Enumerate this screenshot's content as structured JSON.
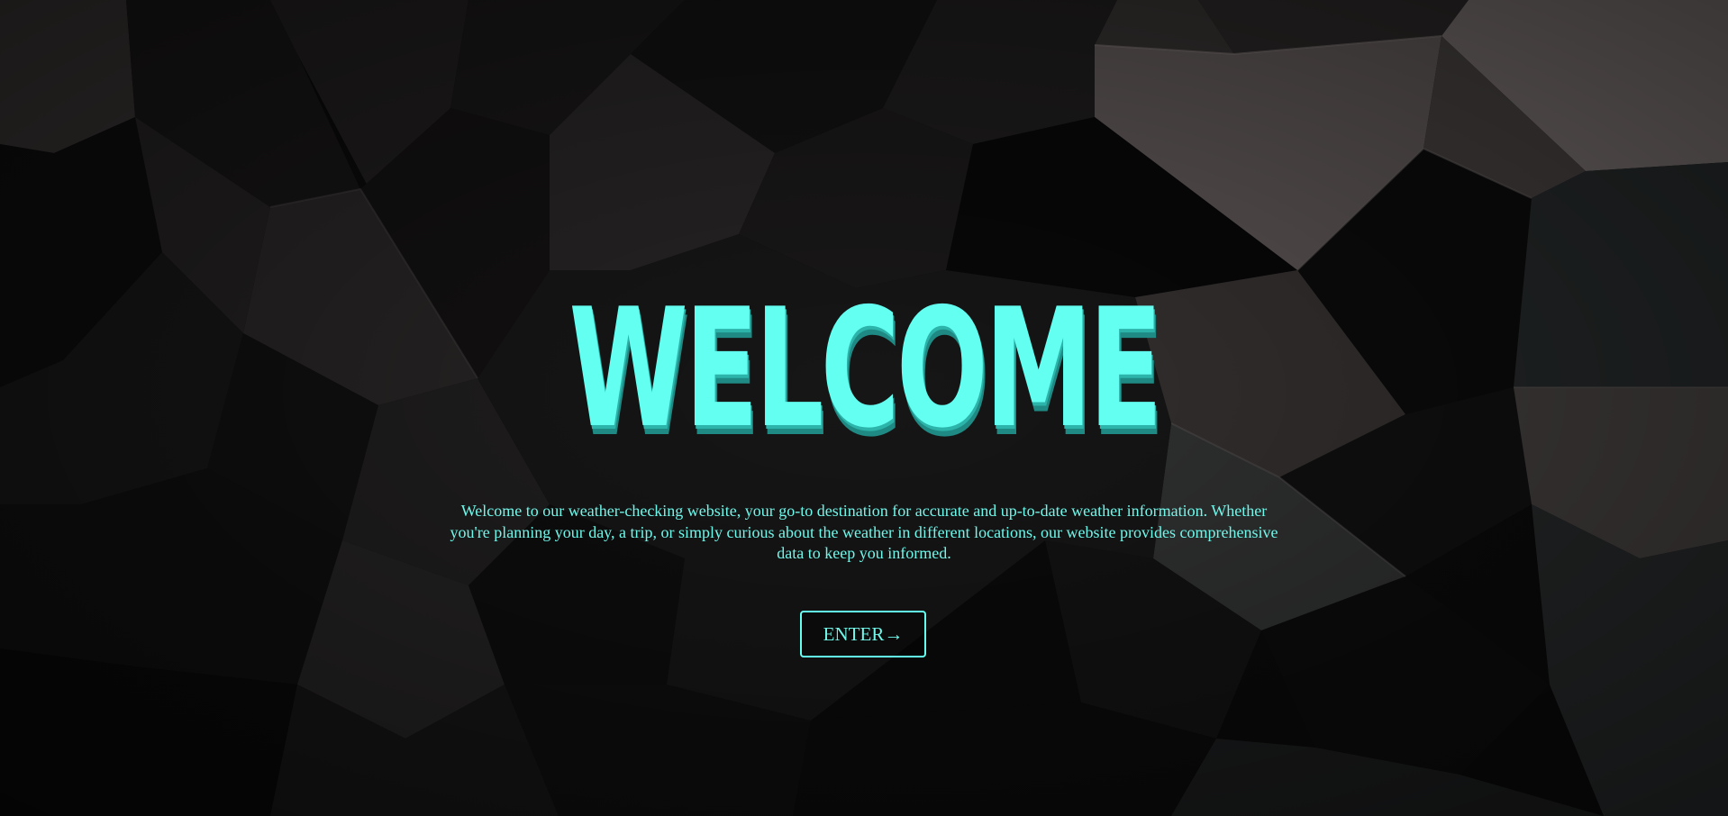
{
  "hero": {
    "title": "WELCOME",
    "description": "Welcome to our weather-checking website, your go-to destination for accurate and up-to-date weather information. Whether you're planning your day, a trip, or simply curious about the weather in different locations, our website provides comprehensive data to keep you informed.",
    "enter_label": "ENTER→"
  },
  "theme": {
    "accent": "#63fff0",
    "background": "#0c0c0d"
  }
}
